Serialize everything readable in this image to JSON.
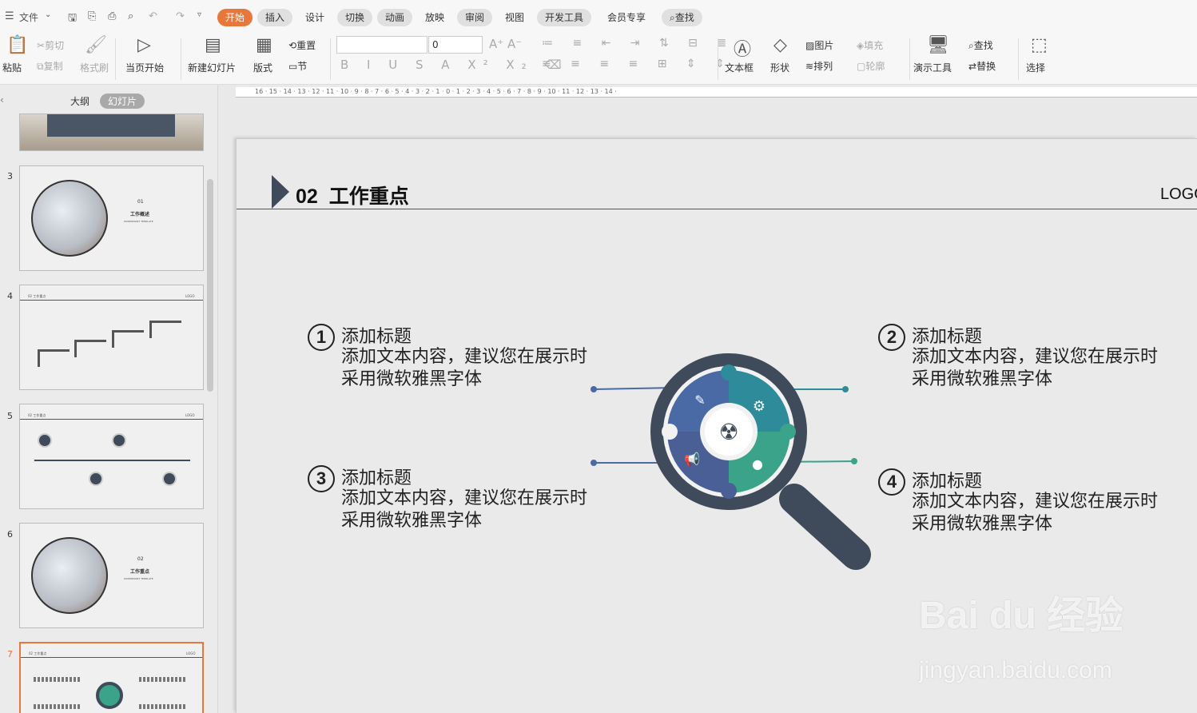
{
  "menu": {
    "file": "文件",
    "tabs": [
      "开始",
      "插入",
      "设计",
      "切换",
      "动画",
      "放映",
      "审阅",
      "视图",
      "开发工具",
      "会员专享"
    ],
    "search": "查找"
  },
  "ribbon": {
    "paste": "粘贴",
    "cut": "剪切",
    "copy": "复制",
    "format_painter": "格式刷",
    "from_current": "当页开始",
    "new_slide": "新建幻灯片",
    "layout": "版式",
    "reset": "重置",
    "section": "节",
    "font_size": "0",
    "textbox": "文本框",
    "shapes": "形状",
    "picture": "图片",
    "fill": "填充",
    "arrange": "排列",
    "outline": "轮廓",
    "present_tools": "演示工具",
    "find": "查找",
    "replace": "替换",
    "select": "选择"
  },
  "panel": {
    "tab_outline": "大纲",
    "tab_slides": "幻灯片",
    "thumbs": [
      {
        "num": "3",
        "label": "01",
        "sub": "工作概述",
        "tiny": "POWERPOINT TEMPLATE"
      },
      {
        "num": "4",
        "head": "02 工作重点",
        "logo": "LOGO"
      },
      {
        "num": "5",
        "head": "02 工作重点",
        "logo": "LOGO"
      },
      {
        "num": "6",
        "label": "02",
        "sub": "工作重点",
        "tiny": "POWERPOINT TEMPLATE"
      },
      {
        "num": "7",
        "head": "02 工作重点",
        "logo": "LOGO"
      }
    ]
  },
  "ruler": "16 · 15 · 14 · 13 · 12 · 11 · 10 · 9 · 8 · 7 · 6 · 5 · 4 · 3 · 2 · 1 · 0 · 1 · 2 · 3 · 4 · 5 · 6 · 7 · 8 · 9 · 10 · 11 · 12 · 13 · 14 ·",
  "slide": {
    "section_num": "02",
    "section_title": "工作重点",
    "logo": "LOGO",
    "items": [
      {
        "num": "1",
        "title": "添加标题",
        "text": "添加文本内容，建议您在展示时采用微软雅黑字体"
      },
      {
        "num": "2",
        "title": "添加标题",
        "text": "添加文本内容，建议您在展示时采用微软雅黑字体"
      },
      {
        "num": "3",
        "title": "添加标题",
        "text": "添加文本内容，建议您在展示时采用微软雅黑字体"
      },
      {
        "num": "4",
        "title": "添加标题",
        "text": "添加文本内容，建议您在展示时采用微软雅黑字体"
      }
    ]
  },
  "watermark": {
    "brand": "Bai du 经验",
    "url": "jingyan.baidu.com"
  },
  "colors": {
    "accent": "#e8773c",
    "navy": "#3f4a5a",
    "blue": "#4a6aa6",
    "teal": "#2e8b9a",
    "green": "#3aa38a"
  }
}
